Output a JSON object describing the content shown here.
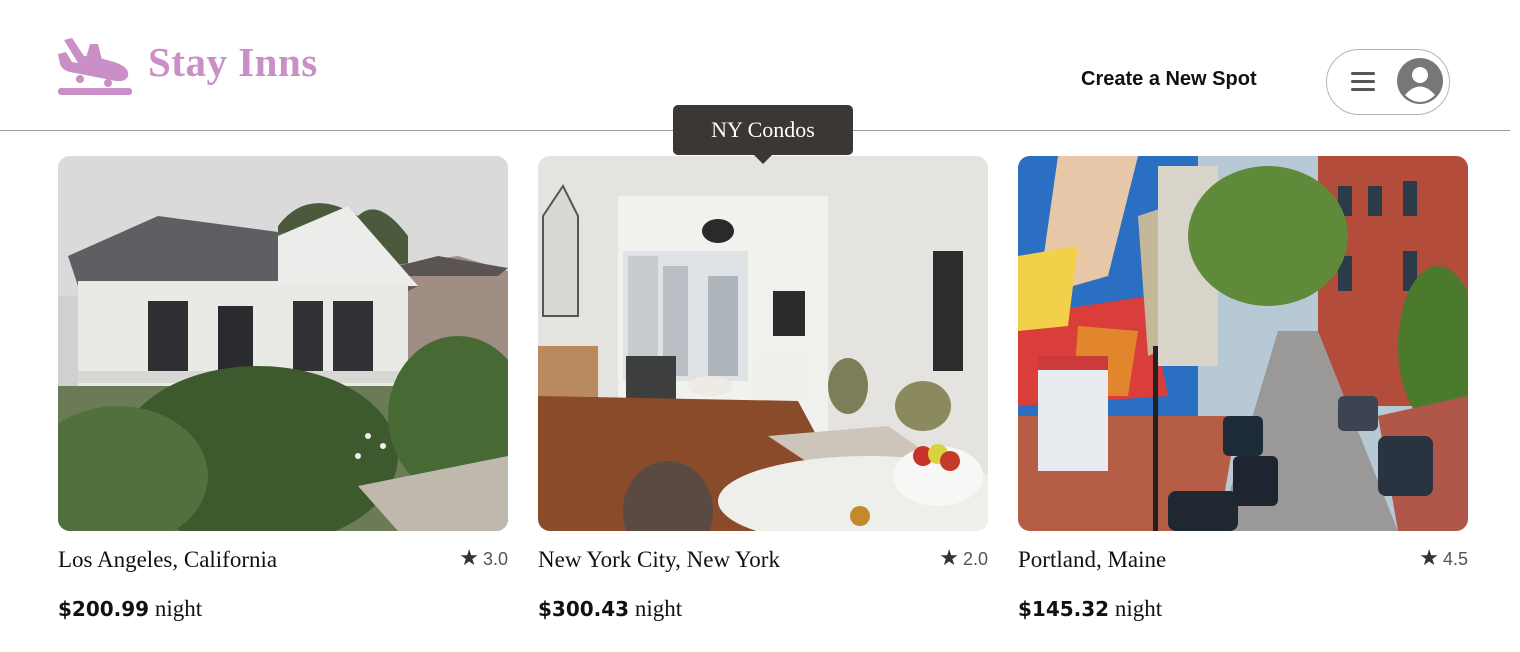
{
  "brand": {
    "name": "Stay Inns",
    "icon": "airplane-landing-icon",
    "color": "#c98fc6"
  },
  "header": {
    "create_spot_label": "Create a New Spot",
    "menu_icon": "hamburger-icon",
    "avatar_icon": "user-avatar-icon"
  },
  "tooltip": {
    "text": "NY Condos"
  },
  "spots": [
    {
      "location": "Los Angeles, California",
      "rating": "3.0",
      "price": "$200.99",
      "unit": "night",
      "image": "white-victorian-cottage-photo"
    },
    {
      "location": "New York City, New York",
      "rating": "2.0",
      "price": "$300.43",
      "unit": "night",
      "image": "modern-condo-living-room-photo"
    },
    {
      "location": "Portland, Maine",
      "rating": "4.5",
      "price": "$145.32",
      "unit": "night",
      "image": "mural-street-scene-photo"
    }
  ]
}
